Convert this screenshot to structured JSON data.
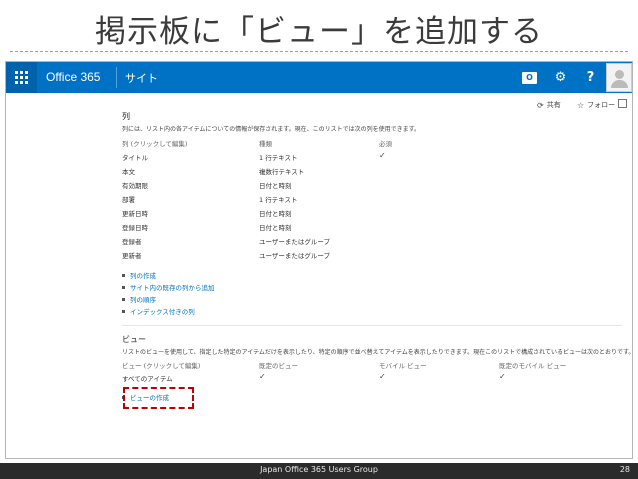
{
  "slide": {
    "title": "掲示板に「ビュー」を追加する",
    "footer": "Japan Office 365 Users Group",
    "page_number": "28"
  },
  "suitebar": {
    "brand": "Office 365",
    "site": "サイト",
    "help": "?",
    "outlook_letter": "O"
  },
  "actions": {
    "share": "共有",
    "follow": "フォロー"
  },
  "columns_section": {
    "title": "列",
    "description": "列には、リスト内の各アイテムについての情報が保存されます。現在、このリストでは次の列を使用できます。",
    "headers": [
      "列 (クリックして編集)",
      "種類",
      "必須"
    ],
    "rows": [
      {
        "name": "タイトル",
        "type": "1 行テキスト",
        "required": "✓"
      },
      {
        "name": "本文",
        "type": "複数行テキスト",
        "required": ""
      },
      {
        "name": "有効期限",
        "type": "日付と時刻",
        "required": ""
      },
      {
        "name": "部署",
        "type": "1 行テキスト",
        "required": ""
      },
      {
        "name": "更新日時",
        "type": "日付と時刻",
        "required": ""
      },
      {
        "name": "登録日時",
        "type": "日付と時刻",
        "required": ""
      },
      {
        "name": "登録者",
        "type": "ユーザーまたはグループ",
        "required": ""
      },
      {
        "name": "更新者",
        "type": "ユーザーまたはグループ",
        "required": ""
      }
    ],
    "links": [
      "列の作成",
      "サイト内の既存の列から追加",
      "列の順序",
      "インデックス付きの列"
    ]
  },
  "views_section": {
    "title": "ビュー",
    "description": "リストのビューを使用して、指定した特定のアイテムだけを表示したり、特定の順序で並べ替えてアイテムを表示したりできます。現在このリストで構成されているビューは次のとおりです。",
    "headers": [
      "ビュー (クリックして編集)",
      "既定のビュー",
      "モバイル ビュー",
      "既定のモバイル ビュー"
    ],
    "rows": [
      {
        "name": "すべてのアイテム",
        "default": "✓",
        "mobile": "✓",
        "default_mobile": "✓"
      }
    ],
    "create_link": "ビューの作成"
  },
  "colors": {
    "suitebar": "#0072c6",
    "link": "#0072c6",
    "highlight": "#c00000",
    "footer": "#2b2b2b"
  },
  "icons": [
    "waffle-icon",
    "outlook-icon",
    "gear-icon",
    "help-icon",
    "avatar-icon",
    "share-icon",
    "follow-star-icon",
    "focus-icon"
  ]
}
